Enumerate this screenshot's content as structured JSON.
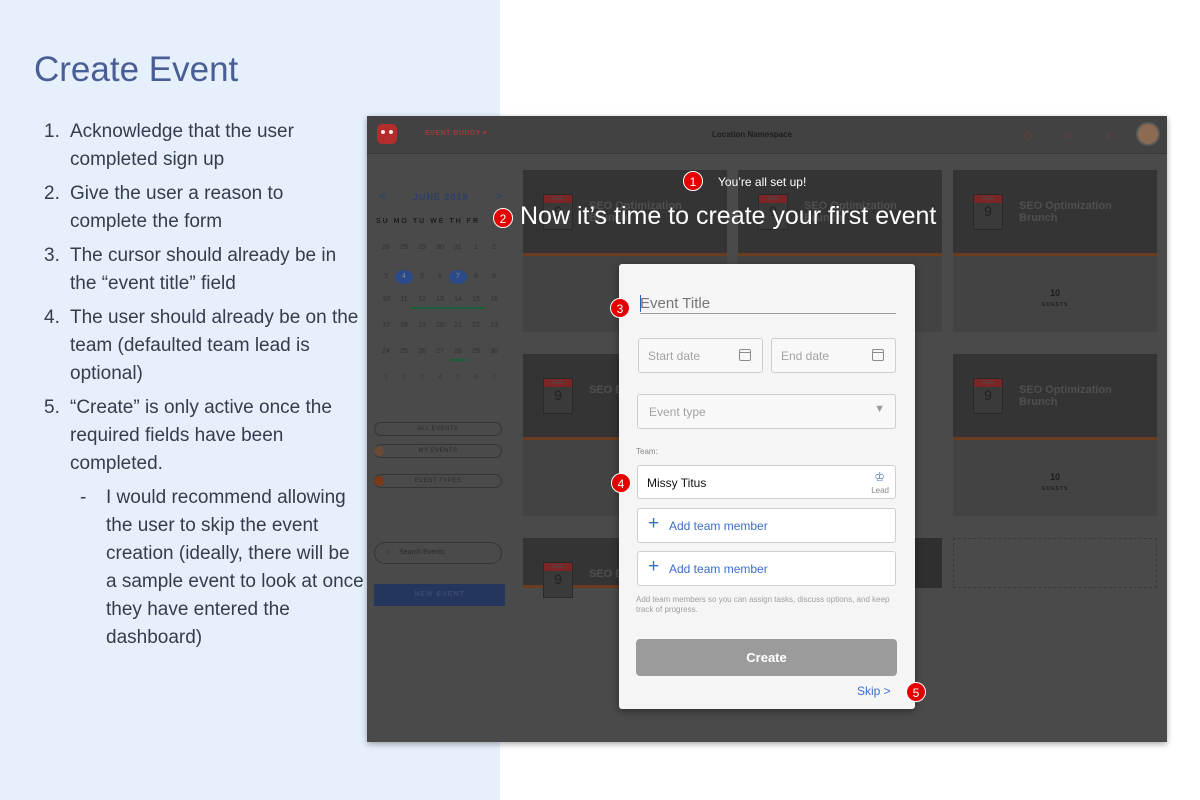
{
  "slide": {
    "title": "Create Event",
    "notes": [
      {
        "num": "1.",
        "text": "Acknowledge that the user completed sign up"
      },
      {
        "num": "2.",
        "text": "Give the user a reason to complete the form"
      },
      {
        "num": "3.",
        "text": "The cursor should already be in the “event title” field"
      },
      {
        "num": "4.",
        "text": "The user should already be on the team (defaulted team lead is optional)"
      },
      {
        "num": "5.",
        "text": "“Create” is only active once the required fields have been completed."
      }
    ],
    "subnote": {
      "dash": "-",
      "text": "I would recommend allowing the user to skip the event creation (ideally, there will be a sample event to look at once they have entered the dashboard)"
    }
  },
  "app": {
    "name": "EVENT BUDDY",
    "name_caret": "▾",
    "location": "Location Namespace",
    "icons": [
      "tag-icon",
      "search-icon",
      "bell-icon"
    ],
    "icon_glyphs": {
      "tag": "◇",
      "search": "○",
      "bell": "♪"
    }
  },
  "calendar": {
    "month": "JUNE 2018",
    "prev": "<",
    "next": ">",
    "weekdays": "SU MO TU WE TH FR",
    "rows": [
      [
        "28",
        "29",
        "29",
        "30",
        "31",
        "1",
        "2"
      ],
      [
        "3",
        "4",
        "5",
        "6",
        "7",
        "8",
        "9"
      ],
      [
        "10",
        "11",
        "12",
        "13",
        "14",
        "15",
        "16"
      ],
      [
        "17",
        "18",
        "19",
        "20",
        "21",
        "22",
        "23"
      ],
      [
        "24",
        "25",
        "26",
        "27",
        "28",
        "29",
        "30"
      ],
      [
        "1",
        "2",
        "3",
        "4",
        "5",
        "6",
        "7"
      ]
    ]
  },
  "sidebar": {
    "all_events": "ALL EVENTS",
    "my_events": "MY EVENTS",
    "event_types": "EVENT TYPES",
    "search": "Search Events",
    "new_event": "NEW EVENT"
  },
  "cards": [
    {
      "title": "SEO Optimization Brunch",
      "month": "MAR",
      "day": "9"
    },
    {
      "title": "SEO Optimization Brunch",
      "month": "MAR",
      "day": "9"
    },
    {
      "title": "SEO Optimization Brunch",
      "month": "MAR",
      "day": "9"
    },
    {
      "title": "SEO Brunch",
      "month": "MAR",
      "day": "9"
    },
    {
      "title": "SEO Optimization Brunch",
      "month": "MAR",
      "day": "9"
    },
    {
      "title": "SEO Brunch",
      "month": "MAR",
      "day": "9"
    }
  ],
  "guests": {
    "count": "10",
    "label": "GUESTS"
  },
  "overlay": {
    "badge1": "1",
    "setup": "You’re all set up!",
    "badge2": "2",
    "headline": "Now it’s time to create your first event",
    "badge3": "3",
    "badge4": "4",
    "badge5": "5"
  },
  "modal": {
    "title_placeholder": "Event Title",
    "start_date": "Start date",
    "end_date": "End date",
    "event_type": "Event type",
    "team_label": "Team:",
    "team_member": "Missy Titus",
    "lead": "Lead",
    "add_member_1": "Add team member",
    "add_member_2": "Add team member",
    "helper": "Add team members so you can assign tasks, discuss options, and keep track of progress.",
    "create": "Create",
    "skip": "Skip >"
  }
}
